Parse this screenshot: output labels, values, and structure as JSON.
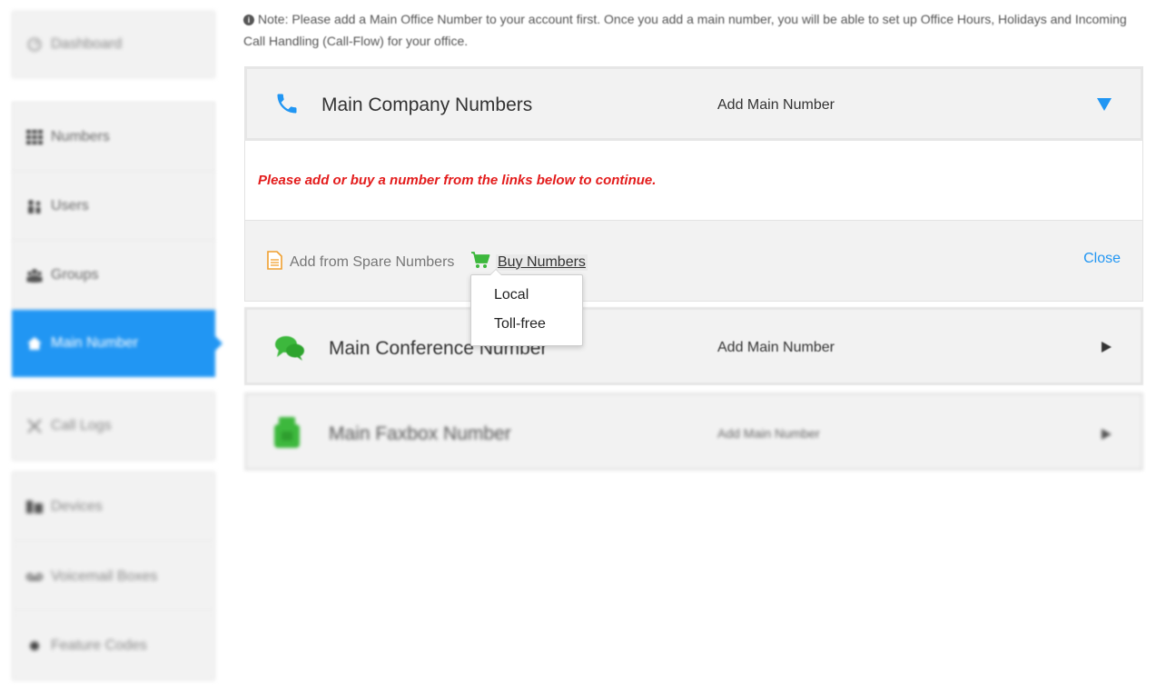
{
  "sidebar": {
    "items": [
      {
        "label": "Dashboard",
        "icon": "dashboard-icon"
      },
      {
        "label": "Numbers",
        "icon": "grid-icon"
      },
      {
        "label": "Users",
        "icon": "users-icon"
      },
      {
        "label": "Groups",
        "icon": "groups-icon"
      },
      {
        "label": "Main Number",
        "icon": "home-icon",
        "active": true
      },
      {
        "label": "Call Logs",
        "icon": "call-logs-icon"
      },
      {
        "label": "Devices",
        "icon": "devices-icon"
      },
      {
        "label": "Voicemail Boxes",
        "icon": "voicemail-icon"
      },
      {
        "label": "Feature Codes",
        "icon": "star-icon"
      }
    ]
  },
  "note": {
    "text": "Note: Please add a Main Office Number to your account first. Once you add a main number, you will be able to set up Office Hours, Holidays and Incoming Call Handling (Call-Flow) for your office."
  },
  "panels": {
    "company": {
      "title": "Main Company Numbers",
      "status": "Add Main Number",
      "icon": "phone-icon",
      "expanded": true,
      "warning": "Please add or buy a number from the links below to continue.",
      "spare_label": "Add from Spare Numbers",
      "buy_label": "Buy Numbers",
      "close_label": "Close"
    },
    "conference": {
      "title": "Main Conference Number",
      "status": "Add Main Number",
      "icon": "chat-icon"
    },
    "faxbox": {
      "title": "Main Faxbox Number",
      "status": "Add Main Number",
      "icon": "fax-icon"
    }
  },
  "buy_menu": {
    "options": [
      "Local",
      "Toll-free"
    ]
  },
  "colors": {
    "accent": "#2196f3",
    "warning": "#e31c1c",
    "icon_green": "#3db83d",
    "doc_orange": "#f0a030"
  }
}
